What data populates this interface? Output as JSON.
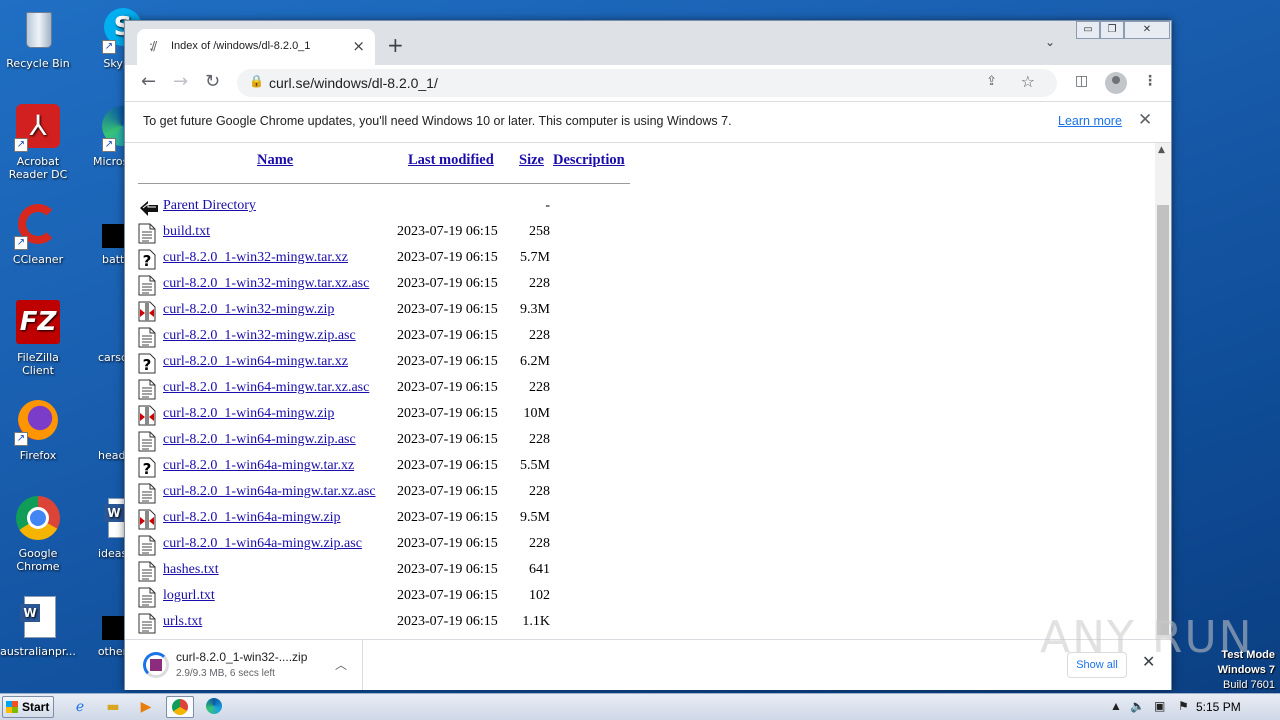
{
  "desktop": {
    "icons": [
      {
        "label": "Recycle Bin"
      },
      {
        "label": "Skype"
      },
      {
        "label": "Acrobat Reader DC"
      },
      {
        "label": "Microsoft"
      },
      {
        "label": "CCleaner"
      },
      {
        "label": "batteryey"
      },
      {
        "label": "FileZilla Client"
      },
      {
        "label": "carscore..."
      },
      {
        "label": "Firefox"
      },
      {
        "label": "headcar..."
      },
      {
        "label": "Google Chrome"
      },
      {
        "label": "ideaspair"
      },
      {
        "label": "australianpr..."
      },
      {
        "label": "othersey"
      }
    ]
  },
  "browser": {
    "tab": {
      "title": "Index of /windows/dl-8.2.0_1",
      "favicon": "curl-favicon"
    },
    "url": "curl.se/windows/dl-8.2.0_1/",
    "infobar": {
      "message": "To get future Google Chrome updates, you'll need Windows 10 or later. This computer is using Windows 7.",
      "learn_more": "Learn more"
    }
  },
  "listing": {
    "headers": {
      "name": "Name",
      "last_modified": "Last modified",
      "size": "Size",
      "description": "Description"
    },
    "rows": [
      {
        "icon": "back-icon",
        "name": "Parent Directory",
        "date": "",
        "size": "-"
      },
      {
        "icon": "text-icon",
        "name": "build.txt",
        "date": "2023-07-19 06:15",
        "size": "258"
      },
      {
        "icon": "unknown-icon",
        "name": "curl-8.2.0_1-win32-mingw.tar.xz",
        "date": "2023-07-19 06:15",
        "size": "5.7M"
      },
      {
        "icon": "text-icon",
        "name": "curl-8.2.0_1-win32-mingw.tar.xz.asc",
        "date": "2023-07-19 06:15",
        "size": "228"
      },
      {
        "icon": "compressed-icon",
        "name": "curl-8.2.0_1-win32-mingw.zip",
        "date": "2023-07-19 06:15",
        "size": "9.3M"
      },
      {
        "icon": "text-icon",
        "name": "curl-8.2.0_1-win32-mingw.zip.asc",
        "date": "2023-07-19 06:15",
        "size": "228"
      },
      {
        "icon": "unknown-icon",
        "name": "curl-8.2.0_1-win64-mingw.tar.xz",
        "date": "2023-07-19 06:15",
        "size": "6.2M"
      },
      {
        "icon": "text-icon",
        "name": "curl-8.2.0_1-win64-mingw.tar.xz.asc",
        "date": "2023-07-19 06:15",
        "size": "228"
      },
      {
        "icon": "compressed-icon",
        "name": "curl-8.2.0_1-win64-mingw.zip",
        "date": "2023-07-19 06:15",
        "size": "10M"
      },
      {
        "icon": "text-icon",
        "name": "curl-8.2.0_1-win64-mingw.zip.asc",
        "date": "2023-07-19 06:15",
        "size": "228"
      },
      {
        "icon": "unknown-icon",
        "name": "curl-8.2.0_1-win64a-mingw.tar.xz",
        "date": "2023-07-19 06:15",
        "size": "5.5M"
      },
      {
        "icon": "text-icon",
        "name": "curl-8.2.0_1-win64a-mingw.tar.xz.asc",
        "date": "2023-07-19 06:15",
        "size": "228"
      },
      {
        "icon": "compressed-icon",
        "name": "curl-8.2.0_1-win64a-mingw.zip",
        "date": "2023-07-19 06:15",
        "size": "9.5M"
      },
      {
        "icon": "text-icon",
        "name": "curl-8.2.0_1-win64a-mingw.zip.asc",
        "date": "2023-07-19 06:15",
        "size": "228"
      },
      {
        "icon": "text-icon",
        "name": "hashes.txt",
        "date": "2023-07-19 06:15",
        "size": "641"
      },
      {
        "icon": "text-icon",
        "name": "logurl.txt",
        "date": "2023-07-19 06:15",
        "size": "102"
      },
      {
        "icon": "text-icon",
        "name": "urls.txt",
        "date": "2023-07-19 06:15",
        "size": "1.1K"
      }
    ]
  },
  "download_shelf": {
    "item": {
      "name": "curl-8.2.0_1-win32-....zip",
      "status": "2.9/9.3 MB, 6 secs left",
      "progress_fraction": 0.31
    },
    "show_all": "Show all"
  },
  "watermark": {
    "anyrun": "ANY RUN",
    "test_mode": "Test Mode",
    "os": "Windows 7",
    "build": "Build 7601"
  },
  "taskbar": {
    "start": "Start",
    "clock": "5:15 PM"
  }
}
